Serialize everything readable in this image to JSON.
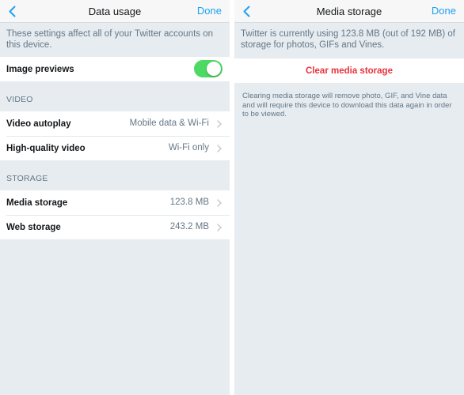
{
  "left": {
    "title": "Data usage",
    "done_label": "Done",
    "description": "These settings affect all of your Twitter accounts on this device.",
    "image_previews": {
      "label": "Image previews",
      "enabled": true
    },
    "video_section": {
      "header": "VIDEO",
      "rows": [
        {
          "label": "Video autoplay",
          "value": "Mobile data & Wi-Fi"
        },
        {
          "label": "High-quality video",
          "value": "Wi-Fi only"
        }
      ]
    },
    "storage_section": {
      "header": "STORAGE",
      "rows": [
        {
          "label": "Media storage",
          "value": "123.8 MB"
        },
        {
          "label": "Web storage",
          "value": "243.2 MB"
        }
      ]
    }
  },
  "right": {
    "title": "Media storage",
    "done_label": "Done",
    "description": "Twitter is currently using 123.8 MB (out of 192 MB) of storage for photos, GIFs and Vines.",
    "clear_label": "Clear media storage",
    "footnote": "Clearing media storage will remove photo, GIF, and Vine data and will require this device to download this data again in order to be viewed."
  },
  "colors": {
    "accent": "#1da1f2",
    "toggle_on": "#4cd964",
    "destructive": "#e8313a",
    "background": "#e6ecf0"
  },
  "icons": [
    "back-chevron-icon",
    "chevron-right-icon"
  ]
}
